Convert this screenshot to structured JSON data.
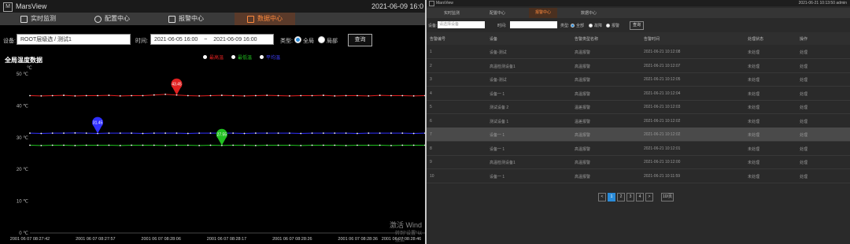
{
  "left": {
    "app_name": "MarsView",
    "clock": "2021-06-09 16:0",
    "tabs": [
      {
        "label": "实时监测",
        "icon": "monitor-icon",
        "active": false
      },
      {
        "label": "配置中心",
        "icon": "gear-icon",
        "active": false
      },
      {
        "label": "报警中心",
        "icon": "alarm-icon",
        "active": false
      },
      {
        "label": "数据中心",
        "icon": "data-icon",
        "active": true
      }
    ],
    "filter": {
      "device_label": "设备:",
      "device_value": "ROOT层级选 / 测试1",
      "time_label": "时间:",
      "start_time": "2021-06-05 16:00",
      "separator": "~",
      "end_time": "2021-06-09 16:00",
      "type_label": "类型:",
      "radio_global": "全局",
      "radio_local": "局部",
      "query_button": "查询"
    },
    "chart_title": "全局温度数据",
    "watermark": "激活 Wind",
    "watermark_sub": "转到\"设置\"以激活"
  },
  "chart_data": {
    "type": "line",
    "title": "全局温度数据",
    "ylabel": "℃",
    "ylim": [
      0,
      50
    ],
    "y_ticks": [
      0,
      10,
      20,
      30,
      40,
      50
    ],
    "y_tick_labels": [
      "0 ℃",
      "10 ℃",
      "20 ℃",
      "30 ℃",
      "40 ℃",
      "50 ℃"
    ],
    "x_tick_labels": [
      "2001 06 07 08:27:42",
      "2001 06 07 08:27:57",
      "2001 06 07 08:28:06",
      "2001 06 07 08:28:17",
      "2001 06 07 08:28:26",
      "2001 06 07 08:28:36",
      "2001 06 07 08:28:46"
    ],
    "grid": false,
    "legend_position": "top",
    "legend": [
      {
        "name": "最高温",
        "color": "#e02020"
      },
      {
        "name": "最低温",
        "color": "#20c020"
      },
      {
        "name": "平均温",
        "color": "#3030ff"
      }
    ],
    "series": [
      {
        "name": "最高温",
        "color": "#e02020",
        "values": [
          43.2,
          43.1,
          43.2,
          43.3,
          43.1,
          43.2,
          43.2,
          43.3,
          43.1,
          43.2,
          43.2,
          43.4,
          43.6,
          43.4,
          43.2,
          43.1,
          43.2,
          43.3,
          43.2,
          43.1,
          43.2,
          43.3,
          43.2,
          43.1,
          43.2,
          43.2,
          43.3,
          43.1,
          43.2,
          43.2,
          43.1,
          43.3,
          43.2,
          43.2,
          43.1,
          43.2
        ],
        "marker": {
          "label": "43.45",
          "index": 13
        }
      },
      {
        "name": "平均温",
        "color": "#3030ff",
        "values": [
          31.4,
          31.3,
          31.4,
          31.4,
          31.45,
          31.4,
          31.3,
          31.4,
          31.4,
          31.4,
          31.3,
          31.4,
          31.4,
          31.4,
          31.3,
          31.4,
          31.4,
          31.4,
          31.4,
          31.3,
          31.4,
          31.4,
          31.4,
          31.4,
          31.3,
          31.4,
          31.4,
          31.4,
          31.4,
          31.3,
          31.4,
          31.4,
          31.4,
          31.4,
          31.3,
          31.4
        ],
        "marker": {
          "label": "31.45",
          "index": 6
        }
      },
      {
        "name": "最低温",
        "color": "#20c020",
        "values": [
          27.6,
          27.5,
          27.6,
          27.6,
          27.5,
          27.6,
          27.6,
          27.6,
          27.5,
          27.6,
          27.6,
          27.6,
          27.5,
          27.6,
          27.6,
          27.5,
          27.6,
          27.55,
          27.6,
          27.6,
          27.5,
          27.6,
          27.6,
          27.6,
          27.5,
          27.6,
          27.6,
          27.6,
          27.5,
          27.6,
          27.6,
          27.6,
          27.5,
          27.6,
          27.6,
          27.6
        ],
        "marker": {
          "label": "27.55",
          "index": 17
        }
      }
    ]
  },
  "right": {
    "title": "MarsView",
    "status": "2021-06-21 10:13:50  admin",
    "tabs": [
      {
        "label": "实时监测",
        "active": false
      },
      {
        "label": "配置中心",
        "active": false
      },
      {
        "label": "报警中心",
        "active": true
      },
      {
        "label": "数据中心",
        "active": false
      }
    ],
    "filter": {
      "device_label": "设备:",
      "device_placeholder": "请选择设备",
      "time_label": "时间:",
      "type_label": "类型:",
      "radio_all": "全部",
      "radio_fault": "故障",
      "radio_alarm": "报警",
      "query_button": "查询"
    },
    "columns": [
      "告警编号",
      "设备",
      "告警类型名称",
      "告警时间",
      "处理状态",
      "操作"
    ],
    "rows": [
      [
        "1",
        "设备-测试",
        "高温报警",
        "2021-06-21 10:12:08",
        "未处理",
        "处理"
      ],
      [
        "2",
        "高温检测设备1",
        "高温报警",
        "2021-06-21 10:12:07",
        "未处理",
        "处理"
      ],
      [
        "3",
        "设备-测试",
        "高温报警",
        "2021-06-21 10:12:05",
        "未处理",
        "处理"
      ],
      [
        "4",
        "设备一 1",
        "高温报警",
        "2021-06-21 10:12:04",
        "未处理",
        "处理"
      ],
      [
        "5",
        "测试设备 2",
        "温差报警",
        "2021-06-21 10:12:03",
        "未处理",
        "处理"
      ],
      [
        "6",
        "测试设备 1",
        "温差报警",
        "2021-06-21 10:12:02",
        "未处理",
        "处理"
      ],
      [
        "7",
        "设备一 1",
        "高温报警",
        "2021-06-21 10:12:02",
        "未处理",
        "处理"
      ],
      [
        "8",
        "设备一 1",
        "高温报警",
        "2021-06-21 10:12:01",
        "未处理",
        "处理"
      ],
      [
        "9",
        "高温检测设备1",
        "高温报警",
        "2021-06-21 10:12:00",
        "未处理",
        "处理"
      ],
      [
        "10",
        "设备一 1",
        "高温报警",
        "2021-06-21 10:11:59",
        "未处理",
        "处理"
      ]
    ],
    "selected_row": 6,
    "pager": [
      "<",
      "1",
      "2",
      "3",
      "4",
      ">"
    ],
    "pager_current": 1,
    "pager_size": "10/页"
  }
}
